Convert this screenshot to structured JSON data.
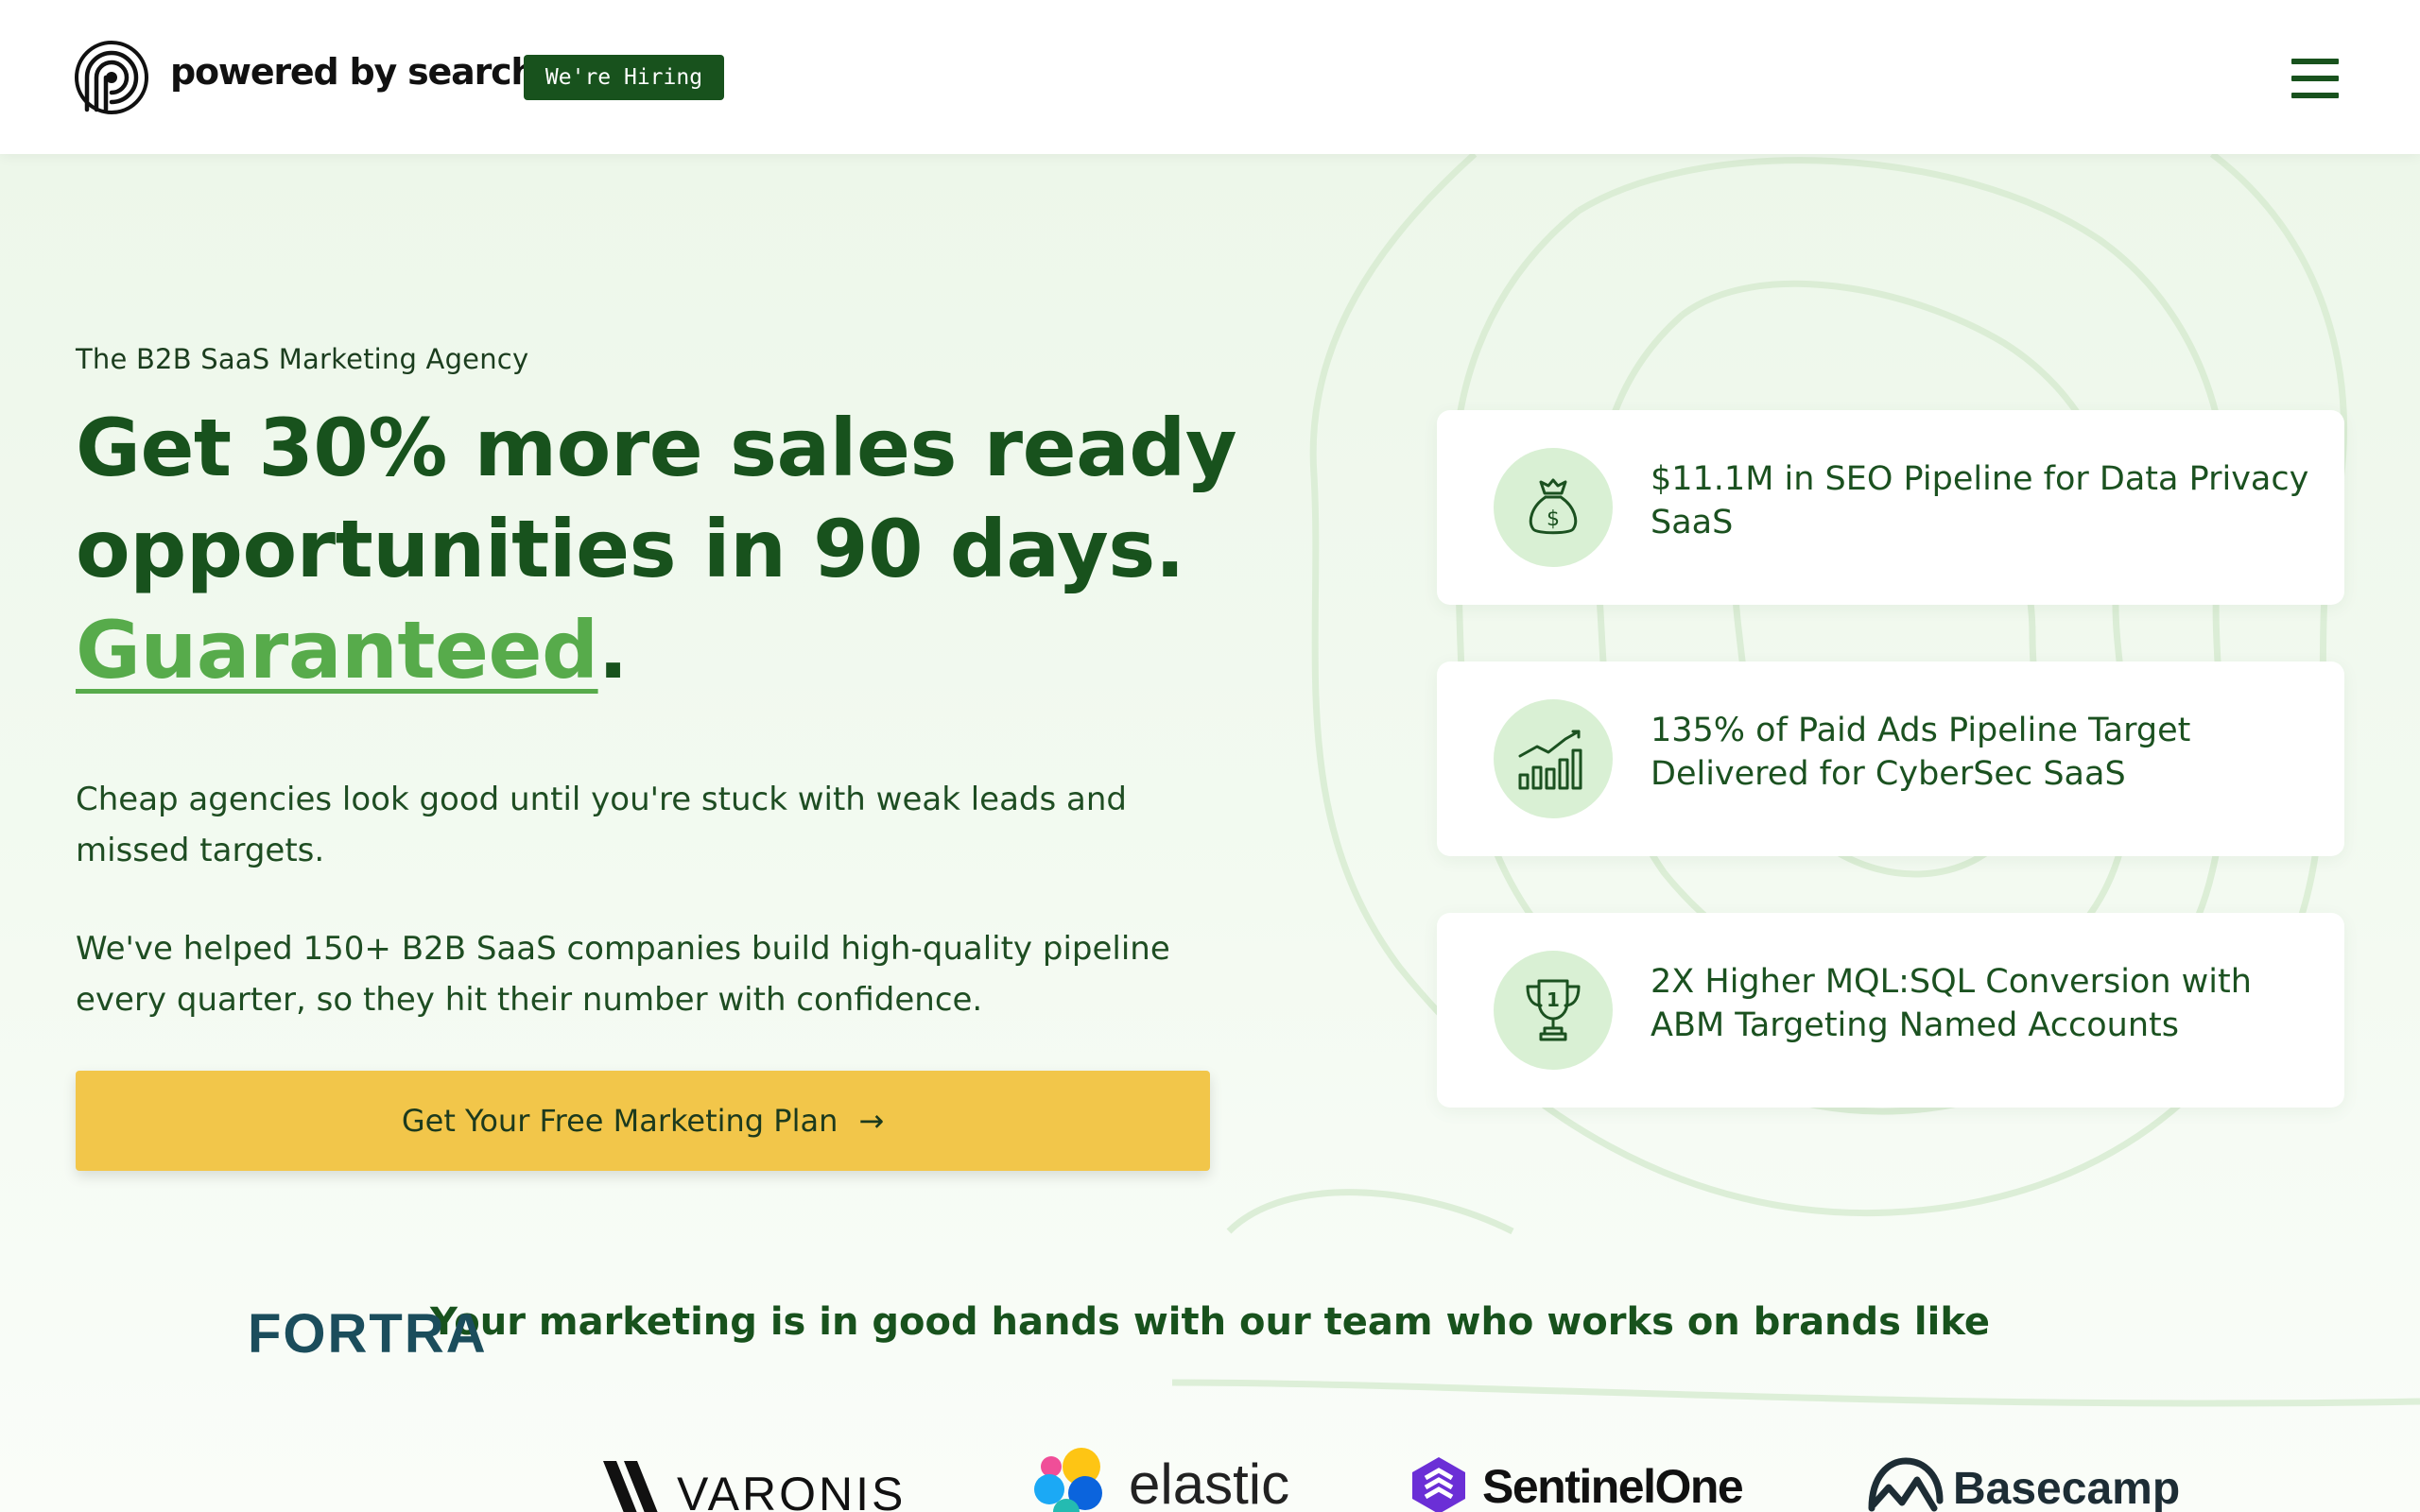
{
  "header": {
    "brand_name": "powered by search",
    "hiring_badge": "We're Hiring",
    "menu_icon": "hamburger-icon"
  },
  "hero": {
    "eyebrow": "The B2B SaaS Marketing Agency",
    "headline_line1": "Get 30% more sales ready",
    "headline_line2": "opportunities in 90 days.",
    "headline_accent": "Guaranteed",
    "headline_period": ".",
    "paragraph1": "Cheap agencies look good until you're stuck with weak leads and missed targets.",
    "paragraph2": "We've helped 150+ B2B SaaS companies build high-quality pipeline every quarter, so they hit their number with confidence.",
    "cta_label": "Get Your Free Marketing Plan",
    "cta_icon": "arrow-right-icon"
  },
  "results": [
    {
      "icon": "money-bag-icon",
      "text": "$11.1M in SEO Pipeline for Data Privacy SaaS"
    },
    {
      "icon": "bar-chart-growth-icon",
      "text": "135% of Paid Ads Pipeline Target Delivered for CyberSec SaaS"
    },
    {
      "icon": "trophy-icon",
      "text": "2X Higher MQL:SQL Conversion with ABM Targeting Named Accounts"
    }
  ],
  "brands": {
    "title": "Your marketing is in good hands with our team who works on brands like",
    "logos": [
      "FORTRA",
      "VARONIS",
      "elastic",
      "SentinelOne",
      "Basecamp"
    ]
  },
  "colors": {
    "brand_green": "#18521d",
    "accent_green": "#57ab4b",
    "cta_yellow": "#f2c64a",
    "hero_bg": "#edf7ea"
  }
}
